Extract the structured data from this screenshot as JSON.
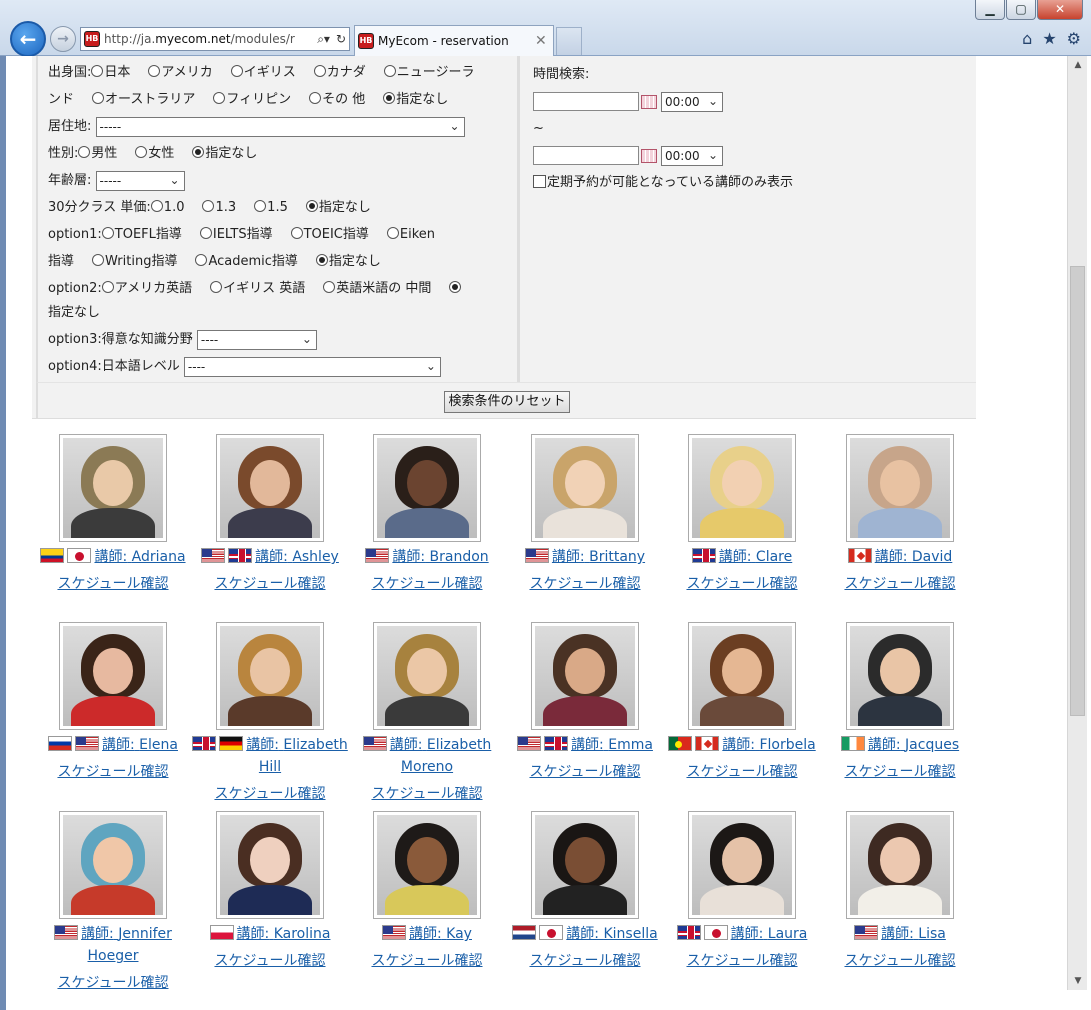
{
  "browser": {
    "url_prefix": "http://ja.",
    "url_domain": "myecom.net",
    "url_suffix": "/modules/r",
    "tab_title": "MyEcom - reservation",
    "favicon_text": "HB"
  },
  "form": {
    "origin": {
      "label": "出身国:",
      "options": [
        "日本",
        "アメリカ",
        "イギリス",
        "カナダ",
        "ニュージーラ",
        "ンド",
        "オーストラリア",
        "フィリピン",
        "その 他",
        "指定なし"
      ],
      "selected": "指定なし"
    },
    "residence": {
      "label": "居住地:",
      "value": "-----"
    },
    "gender": {
      "label": "性別:",
      "options": [
        "男性",
        "女性",
        "指定なし"
      ]
    },
    "age": {
      "label": "年齢層:",
      "value": "-----"
    },
    "price": {
      "label": "30分クラス 単価:",
      "options": [
        "1.0",
        "1.3",
        "1.5",
        "指定なし"
      ]
    },
    "option1": {
      "label": "option1:",
      "options": [
        "TOEFL指導",
        "IELTS指導",
        "TOEIC指導",
        "Eiken",
        "指導",
        "Writing指導",
        "Academic指導",
        "指定なし"
      ]
    },
    "option2": {
      "label": "option2:",
      "options": [
        "アメリカ英語",
        "イギリス 英語",
        "英語米語の 中間",
        "指定なし"
      ]
    },
    "option3": {
      "label": "option3:得意な知識分野",
      "value": "----"
    },
    "option4": {
      "label": "option4:日本語レベル",
      "value": "----"
    },
    "time": {
      "label": "時間検索:",
      "from_time": "00:00",
      "tilde": "~",
      "to_time": "00:00",
      "regular_only": "定期予約が可能となっている講師のみ表示"
    },
    "reset_label": "検索条件のリセット"
  },
  "teachers": [
    {
      "prefix": "講師:",
      "name": "Adriana",
      "flags": [
        "co",
        "jp"
      ],
      "schedule": "スケジュール確認",
      "colors": [
        "#8b7a55",
        "#e9c9a8",
        "#3b3b3b"
      ]
    },
    {
      "prefix": "講師:",
      "name": "Ashley",
      "flags": [
        "us",
        "uk"
      ],
      "schedule": "スケジュール確認",
      "colors": [
        "#7a4a2c",
        "#e2b89a",
        "#3c3c4c"
      ]
    },
    {
      "prefix": "講師:",
      "name": "Brandon",
      "flags": [
        "us"
      ],
      "schedule": "スケジュール確認",
      "colors": [
        "#2a1f19",
        "#6b4430",
        "#5a6b8a"
      ]
    },
    {
      "prefix": "講師:",
      "name": "Brittany",
      "flags": [
        "us"
      ],
      "schedule": "スケジュール確認",
      "colors": [
        "#c9a46a",
        "#f1d2b6",
        "#e9e2da"
      ]
    },
    {
      "prefix": "講師:",
      "name": "Clare",
      "flags": [
        "uk"
      ],
      "schedule": "スケジュール確認",
      "colors": [
        "#e8d08a",
        "#f2d0b2",
        "#e6c96a"
      ]
    },
    {
      "prefix": "講師:",
      "name": "David",
      "flags": [
        "ca"
      ],
      "schedule": "スケジュール確認",
      "colors": [
        "#c7a58a",
        "#e8c2a2",
        "#9fb4d2"
      ]
    },
    {
      "prefix": "講師:",
      "name": "Elena",
      "flags": [
        "ru",
        "us"
      ],
      "schedule": "スケジュール確認",
      "colors": [
        "#3a2418",
        "#e7b9a0",
        "#cc2a2a"
      ]
    },
    {
      "prefix": "講師:",
      "name": "Elizabeth Hill",
      "flags": [
        "uk",
        "de"
      ],
      "schedule": "スケジュール確認",
      "colors": [
        "#b9853e",
        "#e9c4a4",
        "#5a3a2a"
      ]
    },
    {
      "prefix": "講師:",
      "name": "Elizabeth Moreno",
      "flags": [
        "us"
      ],
      "schedule": "スケジュール確認",
      "colors": [
        "#a7823e",
        "#ebc7a6",
        "#3a3a3a"
      ]
    },
    {
      "prefix": "講師:",
      "name": "Emma",
      "flags": [
        "us",
        "uk"
      ],
      "schedule": "スケジュール確認",
      "colors": [
        "#4a3224",
        "#d9a987",
        "#7a2a3a"
      ]
    },
    {
      "prefix": "講師:",
      "name": "Florbela",
      "flags": [
        "pt",
        "ca"
      ],
      "schedule": "スケジュール確認",
      "colors": [
        "#6b3e22",
        "#e5b793",
        "#6a4a3a"
      ]
    },
    {
      "prefix": "講師:",
      "name": "Jacques",
      "flags": [
        "ie"
      ],
      "schedule": "スケジュール確認",
      "colors": [
        "#2b2b2b",
        "#e9c5a6",
        "#2c3440"
      ]
    },
    {
      "prefix": "講師:",
      "name": "Jennifer Hoeger",
      "flags": [
        "us"
      ],
      "schedule": "スケジュール確認",
      "colors": [
        "#5fa5c0",
        "#f0c7a8",
        "#c63a2a"
      ]
    },
    {
      "prefix": "講師:",
      "name": "Karolina",
      "flags": [
        "pl"
      ],
      "schedule": "スケジュール確認",
      "colors": [
        "#4a2e22",
        "#efd0bf",
        "#1e2b55"
      ]
    },
    {
      "prefix": "講師:",
      "name": "Kay",
      "flags": [
        "us"
      ],
      "schedule": "スケジュール確認",
      "colors": [
        "#1e1a18",
        "#8a5a3a",
        "#d8c85a"
      ]
    },
    {
      "prefix": "講師:",
      "name": "Kinsella",
      "flags": [
        "nl",
        "jp"
      ],
      "schedule": "スケジュール確認",
      "colors": [
        "#1a1614",
        "#7a4e34",
        "#222222"
      ]
    },
    {
      "prefix": "講師:",
      "name": "Laura",
      "flags": [
        "uk",
        "jp"
      ],
      "schedule": "スケジュール確認",
      "colors": [
        "#1c1816",
        "#e5c2a8",
        "#e8e0d8"
      ]
    },
    {
      "prefix": "講師:",
      "name": "Lisa",
      "flags": [
        "us"
      ],
      "schedule": "スケジュール確認",
      "colors": [
        "#3e2a22",
        "#ecc8b0",
        "#f2efe8"
      ]
    }
  ]
}
